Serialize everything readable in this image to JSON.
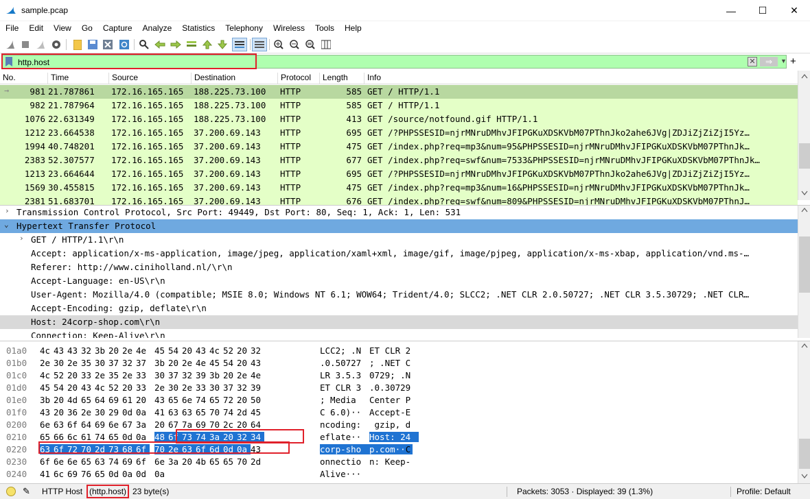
{
  "window": {
    "title": "sample.pcap",
    "minimize": "—",
    "maximize": "☐",
    "close": "✕"
  },
  "menu": [
    "File",
    "Edit",
    "View",
    "Go",
    "Capture",
    "Analyze",
    "Statistics",
    "Telephony",
    "Wireless",
    "Tools",
    "Help"
  ],
  "filter": {
    "value": "http.host",
    "clear": "✕",
    "apply": "⇒",
    "dropdown": "▼",
    "add": "+"
  },
  "packet_list": {
    "columns": [
      "No.",
      "Time",
      "Source",
      "Destination",
      "Protocol",
      "Length",
      "Info"
    ],
    "rows": [
      [
        "981",
        "21.787861",
        "172.16.165.165",
        "188.225.73.100",
        "HTTP",
        "585",
        "GET / HTTP/1.1"
      ],
      [
        "982",
        "21.787964",
        "172.16.165.165",
        "188.225.73.100",
        "HTTP",
        "585",
        "GET / HTTP/1.1"
      ],
      [
        "1076",
        "22.631349",
        "172.16.165.165",
        "188.225.73.100",
        "HTTP",
        "413",
        "GET /source/notfound.gif HTTP/1.1"
      ],
      [
        "1212",
        "23.664538",
        "172.16.165.165",
        "37.200.69.143",
        "HTTP",
        "695",
        "GET /?PHPSSESID=njrMNruDMhvJFIPGKuXDSKVbM07PThnJko2ahe6JVg|ZDJiZjZiZjI5Yz…"
      ],
      [
        "1994",
        "40.748201",
        "172.16.165.165",
        "37.200.69.143",
        "HTTP",
        "475",
        "GET /index.php?req=mp3&num=95&PHPSSESID=njrMNruDMhvJFIPGKuXDSKVbM07PThnJk…"
      ],
      [
        "2383",
        "52.307577",
        "172.16.165.165",
        "37.200.69.143",
        "HTTP",
        "677",
        "GET /index.php?req=swf&num=7533&PHPSSESID=njrMNruDMhvJFIPGKuXDSKVbM07PThnJk…"
      ],
      [
        "1213",
        "23.664644",
        "172.16.165.165",
        "37.200.69.143",
        "HTTP",
        "695",
        "GET /?PHPSSESID=njrMNruDMhvJFIPGKuXDSKVbM07PThnJko2ahe6JVg|ZDJiZjZiZjI5Yz…"
      ],
      [
        "1569",
        "30.455815",
        "172.16.165.165",
        "37.200.69.143",
        "HTTP",
        "475",
        "GET /index.php?req=mp3&num=16&PHPSSESID=njrMNruDMhvJFIPGKuXDSKVbM07PThnJk…"
      ],
      [
        "2381",
        "51.683701",
        "172.16.165.165",
        "37.200.69.143",
        "HTTP",
        "676",
        "GET /index.php?req=swf&num=809&PHPSSESID=njrMNruDMhvJFIPGKuXDSKVbM07PThnJ…"
      ]
    ]
  },
  "details": [
    "Transmission Control Protocol, Src Port: 49449, Dst Port: 80, Seq: 1, Ack: 1, Len: 531",
    "Hypertext Transfer Protocol",
    "GET / HTTP/1.1\\r\\n",
    "Accept: application/x-ms-application, image/jpeg, application/xaml+xml, image/gif, image/pjpeg, application/x-ms-xbap, application/vnd.ms-…",
    "Referer: http://www.ciniholland.nl/\\r\\n",
    "Accept-Language: en-US\\r\\n",
    "User-Agent: Mozilla/4.0 (compatible; MSIE 8.0; Windows NT 6.1; WOW64; Trident/4.0; SLCC2; .NET CLR 2.0.50727; .NET CLR 3.5.30729; .NET CLR…",
    "Accept-Encoding: gzip, deflate\\r\\n",
    "Host: 24corp-shop.com\\r\\n",
    "Connection: Keep-Alive\\r\\n"
  ],
  "bytes": [
    {
      "off": "01a0",
      "hex": [
        "4c",
        "43",
        "43",
        "32",
        "3b",
        "20",
        "2e",
        "4e",
        "45",
        "54",
        "20",
        "43",
        "4c",
        "52",
        "20",
        "32"
      ],
      "ascii": [
        "LCC2; .N",
        "ET CLR 2"
      ]
    },
    {
      "off": "01b0",
      "hex": [
        "2e",
        "30",
        "2e",
        "35",
        "30",
        "37",
        "32",
        "37",
        "3b",
        "20",
        "2e",
        "4e",
        "45",
        "54",
        "20",
        "43"
      ],
      "ascii": [
        ".0.50727",
        "; .NET C"
      ]
    },
    {
      "off": "01c0",
      "hex": [
        "4c",
        "52",
        "20",
        "33",
        "2e",
        "35",
        "2e",
        "33",
        "30",
        "37",
        "32",
        "39",
        "3b",
        "20",
        "2e",
        "4e"
      ],
      "ascii": [
        "LR 3.5.3",
        "0729; .N"
      ]
    },
    {
      "off": "01d0",
      "hex": [
        "45",
        "54",
        "20",
        "43",
        "4c",
        "52",
        "20",
        "33",
        "2e",
        "30",
        "2e",
        "33",
        "30",
        "37",
        "32",
        "39"
      ],
      "ascii": [
        "ET CLR 3",
        ".0.30729"
      ]
    },
    {
      "off": "01e0",
      "hex": [
        "3b",
        "20",
        "4d",
        "65",
        "64",
        "69",
        "61",
        "20",
        "43",
        "65",
        "6e",
        "74",
        "65",
        "72",
        "20",
        "50"
      ],
      "ascii": [
        "; Media ",
        "Center P"
      ]
    },
    {
      "off": "01f0",
      "hex": [
        "43",
        "20",
        "36",
        "2e",
        "30",
        "29",
        "0d",
        "0a",
        "41",
        "63",
        "63",
        "65",
        "70",
        "74",
        "2d",
        "45"
      ],
      "ascii": [
        "C 6.0)··",
        "Accept-E"
      ]
    },
    {
      "off": "0200",
      "hex": [
        "6e",
        "63",
        "6f",
        "64",
        "69",
        "6e",
        "67",
        "3a",
        "20",
        "67",
        "7a",
        "69",
        "70",
        "2c",
        "20",
        "64"
      ],
      "ascii": [
        "ncoding:",
        " gzip, d"
      ]
    },
    {
      "off": "0210",
      "hex": [
        "65",
        "66",
        "6c",
        "61",
        "74",
        "65",
        "0d",
        "0a",
        "48",
        "6f",
        "73",
        "74",
        "3a",
        "20",
        "32",
        "34"
      ],
      "ascii": [
        "eflate··",
        "Host: 24"
      ]
    },
    {
      "off": "0220",
      "hex": [
        "63",
        "6f",
        "72",
        "70",
        "2d",
        "73",
        "68",
        "6f",
        "70",
        "2e",
        "63",
        "6f",
        "6d",
        "0d",
        "0a",
        "43"
      ],
      "ascii": [
        "corp-sho",
        "p.com··C"
      ]
    },
    {
      "off": "0230",
      "hex": [
        "6f",
        "6e",
        "6e",
        "65",
        "63",
        "74",
        "69",
        "6f",
        "6e",
        "3a",
        "20",
        "4b",
        "65",
        "65",
        "70",
        "2d"
      ],
      "ascii": [
        "onnectio",
        "n: Keep-"
      ]
    },
    {
      "off": "0240",
      "hex": [
        "41",
        "6c",
        "69",
        "76",
        "65",
        "0d",
        "0a",
        "0d",
        "0a"
      ],
      "ascii": [
        "Alive···",
        ""
      ]
    }
  ],
  "status": {
    "field": "HTTP Host",
    "filter_name": "(http.host)",
    "size": "23 byte(s)",
    "packets": "Packets: 3053 · Displayed: 39 (1.3%)",
    "profile": "Profile: Default"
  },
  "colors": {
    "filter_ok": "#afffaf",
    "http_row": "#e4ffc7",
    "selection": "#1f73d2",
    "highlight_box": "#e0202a"
  }
}
